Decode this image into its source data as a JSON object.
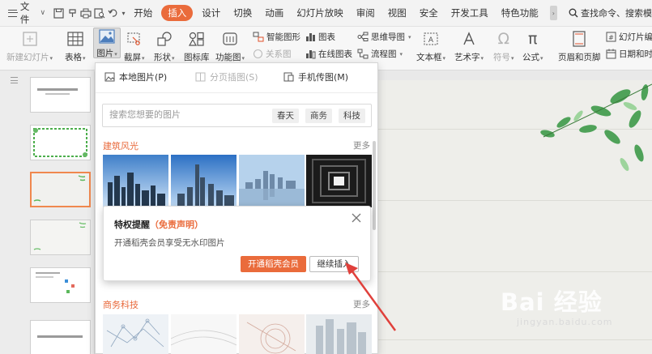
{
  "menubar": {
    "file_label": "文件",
    "tabs": [
      "开始",
      "插入",
      "设计",
      "切换",
      "动画",
      "幻灯片放映",
      "审阅",
      "视图",
      "安全",
      "开发工具",
      "特色功能"
    ],
    "active_tab": "插入",
    "search_label": "查找命令、搜索模"
  },
  "ribbon": {
    "new_slide": "新建幻灯片",
    "table": "表格",
    "picture": "图片",
    "screenshot": "截屏",
    "shape": "形状",
    "icon_lib": "图标库",
    "func_chart": "功能图",
    "smart_shape": "智能图形",
    "chart": "图表",
    "relation": "关系图",
    "online_chart": "在线图表",
    "mind_map": "思维导图",
    "flow_chart": "流程图",
    "textbox": "文本框",
    "art_text": "艺术字",
    "symbol": "符号",
    "formula": "公式",
    "header_footer": "页眉和页脚",
    "slide_number": "幻灯片编",
    "date_time": "日期和时"
  },
  "picture_panel": {
    "tab_local": "本地图片(P)",
    "tab_split": "分页插图(S)",
    "tab_phone": "手机传图(M)",
    "search_placeholder": "搜索您想要的图片",
    "tags": [
      "春天",
      "商务",
      "科技"
    ],
    "section1": "建筑风光",
    "section2": "商务科技",
    "more": "更多"
  },
  "notice": {
    "title": "特权提醒",
    "title_note": "（免责声明）",
    "body": "开通稻壳会员享受无水印图片",
    "primary_button": "开通稻壳会员",
    "secondary_button": "继续插入"
  },
  "watermark": {
    "big": "Bai 经验",
    "small": "jingyan.baidu.com"
  },
  "colors": {
    "accent": "#ea6b3b",
    "annotation_arrow": "#e0403b"
  }
}
